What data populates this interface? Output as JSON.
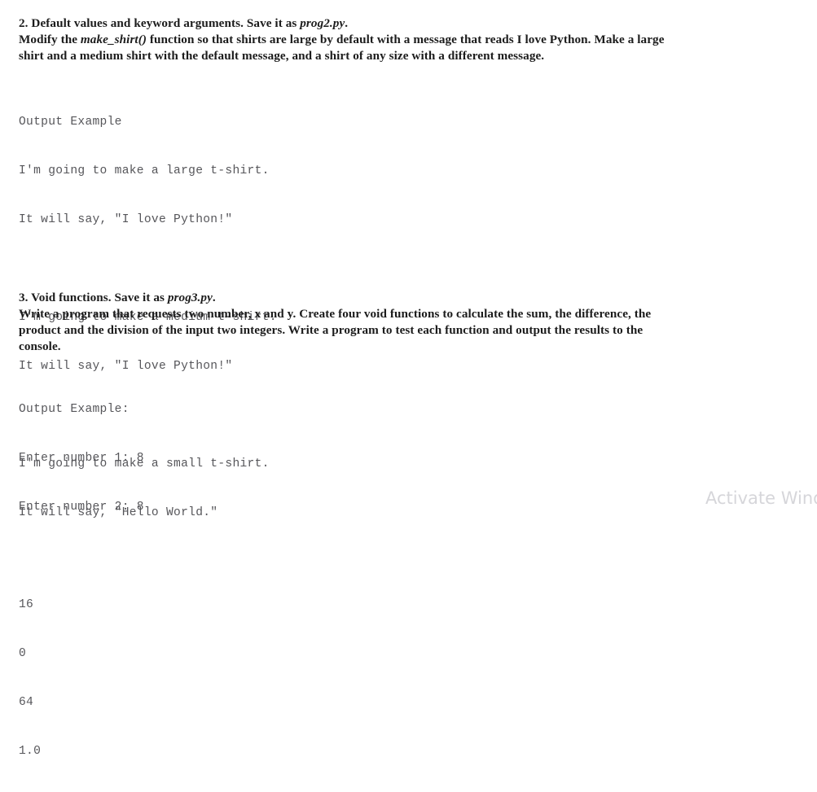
{
  "document": {
    "background_color": "#ffffff",
    "body_text_color": "#1c1c1c",
    "console_text_color": "#56565a",
    "watermark_color": "#d6d6da"
  },
  "sections": [
    {
      "id": "section2",
      "heading_prefix": "2. Default values and keyword arguments.  Save it as ",
      "heading_filename": "prog2.py",
      "heading_suffix": ".",
      "body_part1": "Modify the ",
      "body_function": "make_shirt()",
      "body_part2": " function so that shirts are large by default with a message that reads I love Python. Make a large shirt and a medium shirt with the default message, and a shirt of any size with a different message.",
      "console": {
        "label": "Output Example",
        "lines": [
          "Output Example",
          "I'm going to make a large t-shirt.",
          "It will say, \"I love Python!\"",
          "",
          "I'm going to make a medium t-shirt.",
          "It will say, \"I love Python!\"",
          "",
          "I'm going to make a small t-shirt.",
          "It will say, \"Hello World.\""
        ]
      }
    },
    {
      "id": "section3",
      "heading_prefix": "3. Void functions.  Save it as ",
      "heading_filename": "prog3.py",
      "heading_suffix": ".",
      "body_part1": "Write a program that requests two number, x and y. Create four void functions to calculate the sum, the difference, the product and the division of the input two integers. Write a program to test each function and output the results to the console.",
      "body_function": "",
      "body_part2": "",
      "console": {
        "label": "Output Example:",
        "lines": [
          "Output Example:",
          "Enter number 1: 8",
          "Enter number 2: 8",
          "",
          "16",
          "0",
          "64",
          "1.0"
        ]
      }
    }
  ],
  "watermark": {
    "text": "Activate Windows"
  }
}
